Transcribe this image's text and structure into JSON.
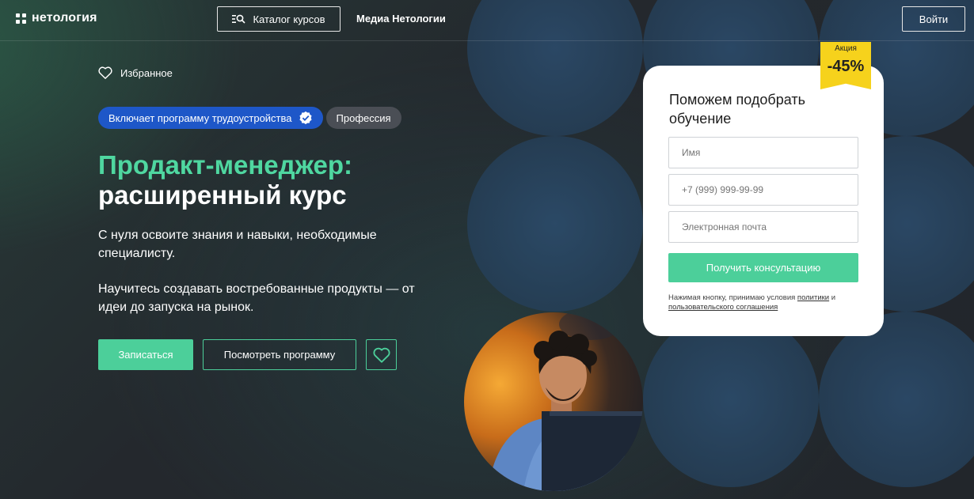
{
  "header": {
    "logo_text": "нетология",
    "catalog_label": "Каталог курсов",
    "media_label": "Медиа Нетологии",
    "login_label": "Войти"
  },
  "hero": {
    "favorites_label": "Избранное",
    "badges": {
      "employment": "Включает программу трудоустройства",
      "type": "Профессия"
    },
    "title_line1": "Продакт-менеджер:",
    "title_line2": "расширенный курс",
    "description_1": "С нуля освоите знания и навыки, необходимые специалисту.",
    "description_2": "Научитесь создавать востребованные продукты — от идеи до запуска на рынок.",
    "signup_label": "Записаться",
    "program_label": "Посмотреть программу"
  },
  "form": {
    "title": "Поможем подобрать обучение",
    "name_placeholder": "Имя",
    "phone_placeholder": "+7 (999) 999-99-99",
    "email_placeholder": "Электронная почта",
    "submit_label": "Получить консультацию",
    "legal_prefix": "Нажимая кнопку, принимаю условия",
    "legal_link1": "политики",
    "legal_and": "и",
    "legal_link2": "пользовательского соглашения"
  },
  "promo": {
    "label": "Акция",
    "value": "-45%"
  },
  "colors": {
    "accent": "#4ccf9a",
    "title_green": "#4fd7a0",
    "badge_blue": "#1e57c8",
    "promo_yellow": "#f6d21c"
  },
  "icons": [
    "logo-icon",
    "catalog-search-icon",
    "heart-icon",
    "verified-check-icon"
  ]
}
